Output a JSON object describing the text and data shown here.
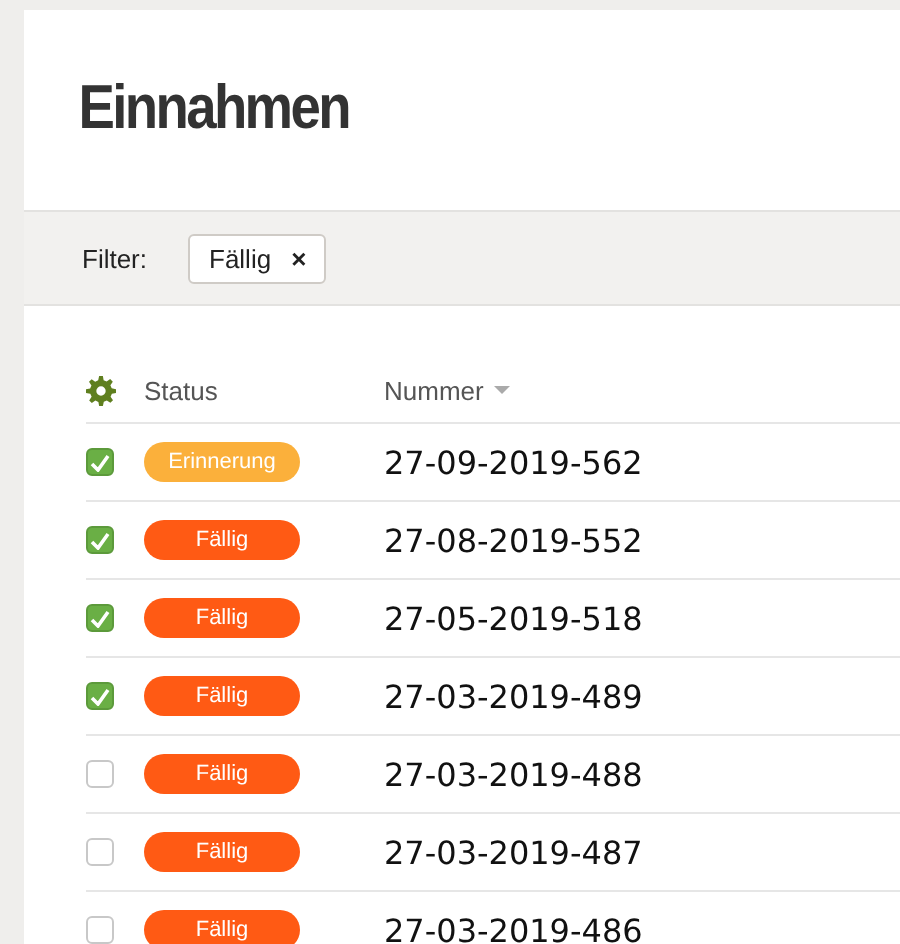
{
  "page": {
    "title": "Einnahmen"
  },
  "filter": {
    "label": "Filter:",
    "chips": [
      {
        "label": "Fällig",
        "remove": "×"
      }
    ]
  },
  "table": {
    "columns": [
      {
        "label": "Status"
      },
      {
        "label": "Nummer",
        "sorted": true
      }
    ],
    "rows": [
      {
        "checked": true,
        "status": "Erinnerung",
        "color": "#fbb03b",
        "number": "27-09-2019-562"
      },
      {
        "checked": true,
        "status": "Fällig",
        "color": "#ff5a14",
        "number": "27-08-2019-552"
      },
      {
        "checked": true,
        "status": "Fällig",
        "color": "#ff5a14",
        "number": "27-05-2019-518"
      },
      {
        "checked": true,
        "status": "Fällig",
        "color": "#ff5a14",
        "number": "27-03-2019-489"
      },
      {
        "checked": false,
        "status": "Fällig",
        "color": "#ff5a14",
        "number": "27-03-2019-488"
      },
      {
        "checked": false,
        "status": "Fällig",
        "color": "#ff5a14",
        "number": "27-03-2019-487"
      },
      {
        "checked": false,
        "status": "Fällig",
        "color": "#ff5a14",
        "number": "27-03-2019-486"
      }
    ]
  }
}
